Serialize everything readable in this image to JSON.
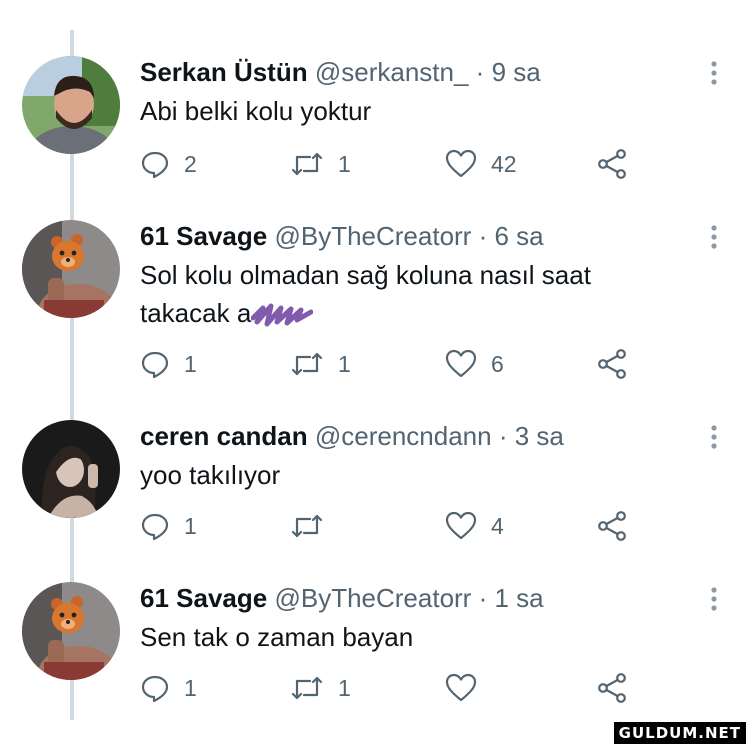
{
  "tweets": [
    {
      "name": "Serkan Üstün",
      "handle": "@serkanstn_",
      "time": "9 sa",
      "text": "Abi belki kolu yoktur",
      "replies": "2",
      "retweets": "1",
      "likes": "42",
      "avatar_icon": "man-portrait-avatar"
    },
    {
      "name": "61 Savage",
      "handle": "@ByTheCreatorr",
      "time": "6 sa",
      "text": "Sol kolu olmadan sağ koluna nasıl saat",
      "text_line2": "takacak a",
      "replies": "1",
      "retweets": "1",
      "likes": "6",
      "avatar_icon": "bear-mask-avatar"
    },
    {
      "name": "ceren candan",
      "handle": "@cerencndann",
      "time": "3 sa",
      "text": "yoo takılıyor",
      "replies": "1",
      "retweets": "",
      "likes": "4",
      "avatar_icon": "woman-portrait-avatar"
    },
    {
      "name": "61 Savage",
      "handle": "@ByTheCreatorr",
      "time": "1 sa",
      "text": "Sen tak o zaman bayan",
      "replies": "1",
      "retweets": "1",
      "likes": "",
      "avatar_icon": "bear-mask-avatar"
    }
  ],
  "separator": "·",
  "watermark": "GULDUM.NET",
  "colors": {
    "text": "#0f1419",
    "secondary": "#536471",
    "thread_line": "#cfd9de",
    "scribble": "#6b3fa0"
  },
  "icons": [
    "reply-icon",
    "retweet-icon",
    "like-icon",
    "share-icon",
    "more-options-icon"
  ]
}
